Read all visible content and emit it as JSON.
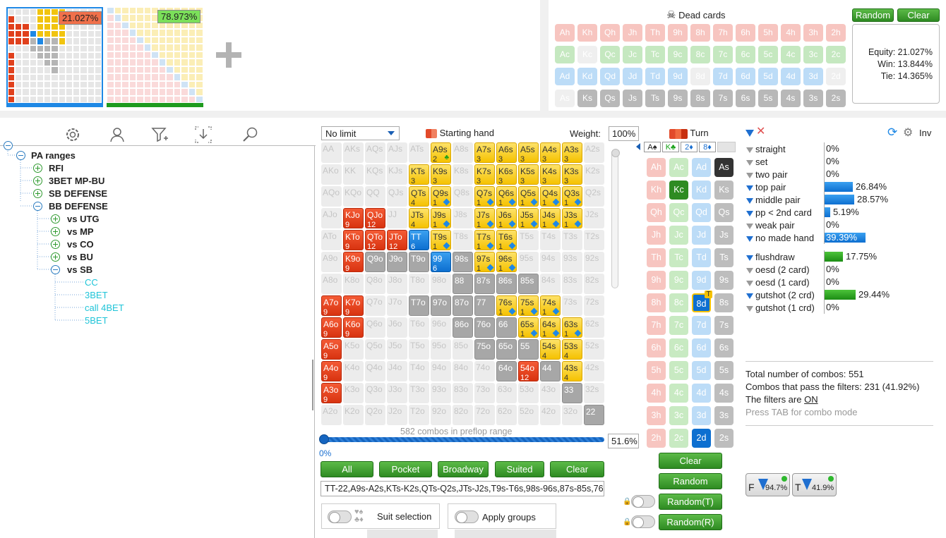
{
  "top": {
    "range1_equity": "21.027%",
    "range2_equity": "78.973%",
    "dead_cards_title": "Dead cards",
    "random_label": "Random",
    "clear_label": "Clear",
    "equity": "Equity: 21.027%",
    "win": "Win: 13.844%",
    "tie": "Tie: 14.365%"
  },
  "dead_cards": [
    [
      "Ah",
      "Kh",
      "Qh",
      "Jh",
      "Th",
      "9h",
      "8h",
      "7h",
      "6h",
      "5h",
      "4h",
      "3h",
      "2h"
    ],
    [
      "Ac",
      "Kc",
      "Qc",
      "Jc",
      "Tc",
      "9c",
      "8c",
      "7c",
      "6c",
      "5c",
      "4c",
      "3c",
      "2c"
    ],
    [
      "Ad",
      "Kd",
      "Qd",
      "Jd",
      "Td",
      "9d",
      "8d",
      "7d",
      "6d",
      "5d",
      "4d",
      "3d",
      "2d"
    ],
    [
      "As",
      "Ks",
      "Qs",
      "Js",
      "Ts",
      "9s",
      "8s",
      "7s",
      "6s",
      "5s",
      "4s",
      "3s",
      "2s"
    ]
  ],
  "tree": {
    "root": "PA ranges",
    "items": [
      "RFI",
      "3BET MP-BU",
      "SB DEFENSE",
      "BB DEFENSE"
    ],
    "sub": [
      "vs UTG",
      "vs MP",
      "vs CO",
      "vs BU",
      "vs SB"
    ],
    "leaves": [
      "CC",
      "3BET",
      "call 4BET",
      "5BET"
    ]
  },
  "matrix": {
    "game_select": "No limit",
    "starting_hand_label": "Starting hand",
    "weight_label": "Weight:",
    "weight_value": "100%",
    "combos_text": "582 combos in preflop range",
    "slider_min": "0%",
    "slider_value": "51.6%",
    "slider_fraction": 0.516,
    "buttons": [
      "All",
      "Pocket",
      "Broadway",
      "Suited",
      "Clear"
    ],
    "range_text": "TT-22,A9s-A2s,KTs-K2s,QTs-Q2s,JTs-J2s,T9s-T6s,98s-96s,87s-85s,76",
    "suit_selection": "Suit selection",
    "apply_groups": "Apply groups"
  },
  "turn": {
    "title": "Turn",
    "board": [
      "A♠",
      "K♣",
      "2♦",
      "8♦"
    ],
    "clear": "Clear",
    "random": "Random",
    "random_t": "Random(T)",
    "random_r": "Random(R)"
  },
  "turn_cards": [
    [
      "Ah",
      "Ac",
      "Ad",
      "As"
    ],
    [
      "Kh",
      "Kc",
      "Kd",
      "Ks"
    ],
    [
      "Qh",
      "Qc",
      "Qd",
      "Qs"
    ],
    [
      "Jh",
      "Jc",
      "Jd",
      "Js"
    ],
    [
      "Th",
      "Tc",
      "Td",
      "Ts"
    ],
    [
      "9h",
      "9c",
      "9d",
      "9s"
    ],
    [
      "8h",
      "8c",
      "8d",
      "8s"
    ],
    [
      "7h",
      "7c",
      "7d",
      "7s"
    ],
    [
      "6h",
      "6c",
      "6d",
      "6s"
    ],
    [
      "5h",
      "5c",
      "5d",
      "5s"
    ],
    [
      "4h",
      "4c",
      "4d",
      "4s"
    ],
    [
      "3h",
      "3c",
      "3d",
      "3s"
    ],
    [
      "2h",
      "2c",
      "2d",
      "2s"
    ]
  ],
  "filters": {
    "inv_label": "Inv",
    "rows": [
      {
        "name": "straight",
        "value": "0%",
        "frac": 0
      },
      {
        "name": "set",
        "value": "0%",
        "frac": 0
      },
      {
        "name": "two pair",
        "value": "0%",
        "frac": 0
      },
      {
        "name": "top pair",
        "value": "26.84%",
        "frac": 0.268
      },
      {
        "name": "middle pair",
        "value": "28.57%",
        "frac": 0.286
      },
      {
        "name": "pp < 2nd card",
        "value": "5.19%",
        "frac": 0.052
      },
      {
        "name": "weak pair",
        "value": "0%",
        "frac": 0
      },
      {
        "name": "no made hand",
        "value": "39.39%",
        "frac": 0.394
      }
    ],
    "draws": [
      {
        "name": "flushdraw",
        "value": "17.75%",
        "frac": 0.178
      },
      {
        "name": "oesd (2 card)",
        "value": "0%",
        "frac": 0
      },
      {
        "name": "oesd (1 card)",
        "value": "0%",
        "frac": 0
      },
      {
        "name": "gutshot (2 crd)",
        "value": "29.44%",
        "frac": 0.294
      },
      {
        "name": "gutshot (1 crd)",
        "value": "0%",
        "frac": 0
      }
    ],
    "total": "Total number of combos: 551",
    "pass": "Combos that pass the filters: 231 (41.92%)",
    "on_prefix": "The filters are ",
    "on": "ON",
    "hint": "Press TAB for combo mode",
    "f_pct": "94.7%",
    "t_pct": "41.9%",
    "f_letter": "F",
    "t_letter": "T"
  }
}
